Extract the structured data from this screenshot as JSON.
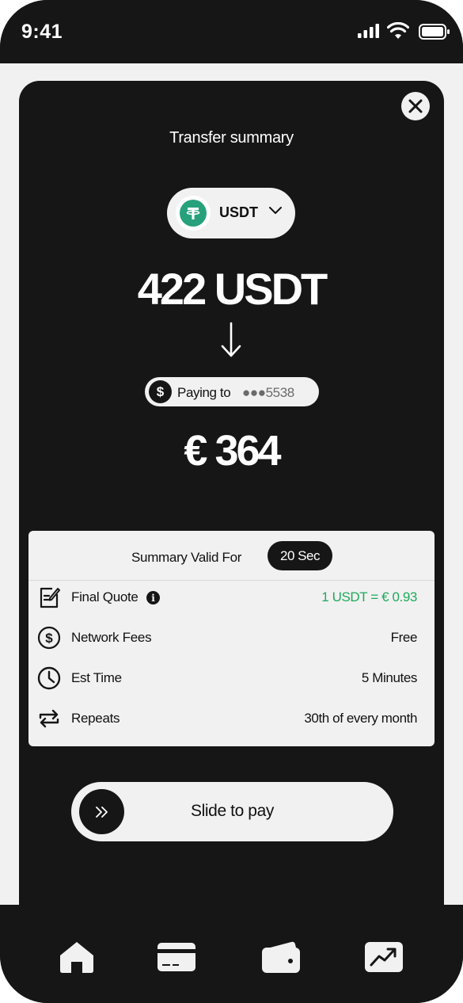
{
  "status_bar": {
    "time": "9:41"
  },
  "sheet": {
    "title": "Transfer summary",
    "token": {
      "symbol": "USDT",
      "icon": "tether-icon",
      "brand_color": "#26a17b"
    },
    "amount": "422 USDT",
    "paying_to": {
      "label": "Paying to",
      "account": "●●●5538"
    },
    "converted_amount": "€ 364"
  },
  "summary": {
    "valid_label": "Summary Valid For",
    "valid_timer": "20 Sec",
    "rows": [
      {
        "label": "Final Quote",
        "value": "1 USDT = € 0.93",
        "icon": "quote-icon",
        "value_color": "#1faa5c"
      },
      {
        "label": "Network Fees",
        "value": "Free",
        "icon": "dollar-circle-icon"
      },
      {
        "label": "Est Time",
        "value": "5 Minutes",
        "icon": "clock-icon"
      },
      {
        "label": "Repeats",
        "value": "30th of every month",
        "icon": "repeat-icon"
      }
    ]
  },
  "slider": {
    "label": "Slide to pay"
  },
  "tabbar": {
    "items": [
      "home-icon",
      "card-icon",
      "wallet-icon",
      "chart-icon"
    ]
  }
}
